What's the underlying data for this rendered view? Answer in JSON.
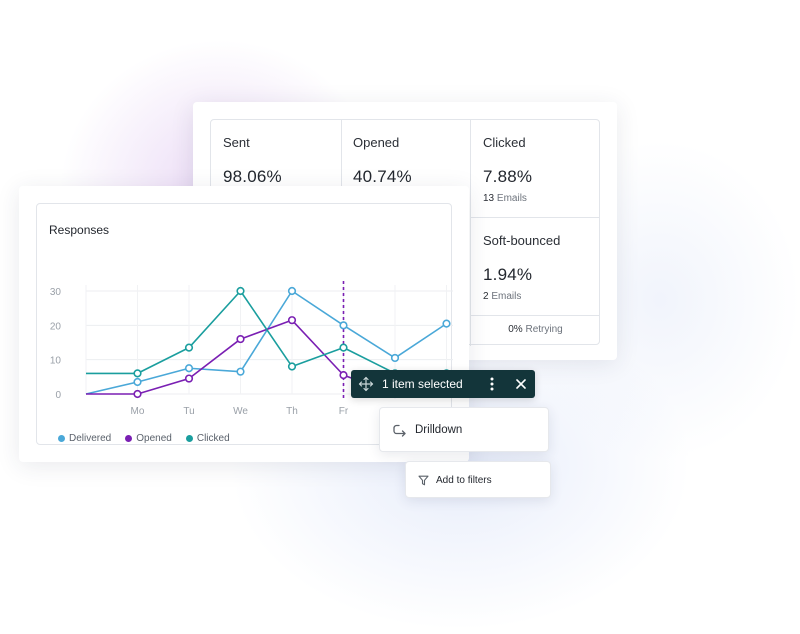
{
  "stats": {
    "sent": {
      "label": "Sent",
      "value": "98.06%"
    },
    "opened": {
      "label": "Opened",
      "value": "40.74%"
    },
    "clicked": {
      "label": "Clicked",
      "value": "7.88%",
      "count": "13",
      "unit": "Emails"
    },
    "soft_bounced": {
      "label": "Soft-bounced",
      "value": "1.94%",
      "count": "2",
      "unit": "Emails"
    },
    "retrying": {
      "percent": "0%",
      "label": "Retrying"
    }
  },
  "chart_data": {
    "type": "line",
    "title": "Responses",
    "categories": [
      "",
      "Mo",
      "Tu",
      "We",
      "Th",
      "Fr",
      "",
      ""
    ],
    "y_ticks": [
      0,
      10,
      20,
      30
    ],
    "ylim": [
      0,
      32
    ],
    "grid": true,
    "legend_position": "bottom-left",
    "highlight_category_index": 5,
    "highlight_color": "#7a1fb3",
    "series": [
      {
        "name": "Delivered",
        "color": "#4aa8d8",
        "values": [
          0,
          3.5,
          7.5,
          6.5,
          30,
          20,
          10.5,
          20.5
        ]
      },
      {
        "name": "Opened",
        "color": "#7a1fb3",
        "values": [
          0,
          0,
          4.5,
          16,
          21.5,
          5.5,
          0,
          null
        ]
      },
      {
        "name": "Clicked",
        "color": "#1a9e9e",
        "values": [
          6,
          6,
          13.5,
          30,
          8,
          13.5,
          6,
          6
        ]
      }
    ]
  },
  "selection": {
    "text": "1 item selected"
  },
  "menu": {
    "drilldown": "Drilldown",
    "add_filters": "Add to filters"
  }
}
